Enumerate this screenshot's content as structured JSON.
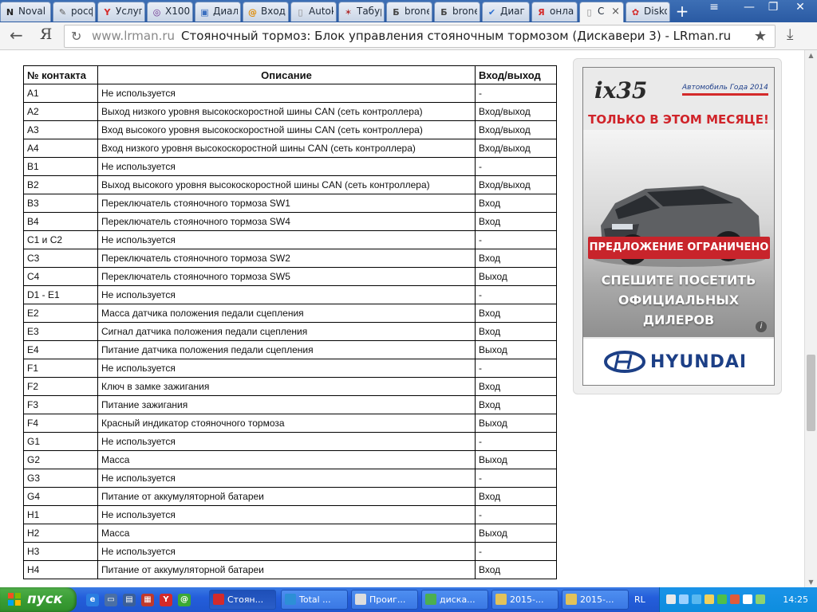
{
  "browser": {
    "tabs": [
      {
        "label": "Noval",
        "icon": "novalis-icon",
        "fav": "N",
        "fav_color": "#222222"
      },
      {
        "label": "росф",
        "icon": "feather-icon",
        "fav": "✎",
        "fav_color": "#555555"
      },
      {
        "label": "Услуг",
        "icon": "yandex-icon",
        "fav": "Y",
        "fav_color": "#d42a2a"
      },
      {
        "label": "X100",
        "icon": "x100-icon",
        "fav": "◎",
        "fav_color": "#6a2c8c"
      },
      {
        "label": "Диал",
        "icon": "dialog-icon",
        "fav": "▣",
        "fav_color": "#3a6fc0"
      },
      {
        "label": "Вход",
        "icon": "login-icon",
        "fav": "@",
        "fav_color": "#e08a00"
      },
      {
        "label": "Autok",
        "icon": "page-icon",
        "fav": "▯",
        "fav_color": "#888888"
      },
      {
        "label": "Табур",
        "icon": "star-badge-icon",
        "fav": "✶",
        "fav_color": "#b03030"
      },
      {
        "label": "brone",
        "icon": "b-icon",
        "fav": "Б",
        "fav_color": "#444444"
      },
      {
        "label": "brone",
        "icon": "b-icon",
        "fav": "Б",
        "fav_color": "#444444"
      },
      {
        "label": "Диаг",
        "icon": "check-icon",
        "fav": "✔",
        "fav_color": "#2d6fd0"
      },
      {
        "label": "онлаі",
        "icon": "yandex-ya-icon",
        "fav": "Я",
        "fav_color": "#d42a2a"
      },
      {
        "label": "С",
        "icon": "page-icon",
        "fav": "▯",
        "fav_color": "#888888",
        "active": true
      },
      {
        "label": "Disko",
        "icon": "disko-icon",
        "fav": "✿",
        "fav_color": "#d42a2a"
      }
    ],
    "new_tab": "+",
    "close_tab": "×",
    "window_buttons": {
      "menu": "≡",
      "minimize": "—",
      "maximize": "❐",
      "close": "✕"
    },
    "address": {
      "domain": "www.lrman.ru",
      "title": "Стояночный тормоз: Блок управления стояночным тормозом (Дискавери 3) - LRman.ru"
    },
    "nav": {
      "back": "←",
      "yandex": "Я",
      "reload": "↻",
      "star": "★",
      "download": "⤓"
    }
  },
  "table": {
    "headers": [
      "№ контакта",
      "Описание",
      "Вход/выход"
    ],
    "rows": [
      [
        "A1",
        "Не используется",
        "-"
      ],
      [
        "A2",
        "Выход низкого уровня высокоскоростной шины CAN (сеть контроллера)",
        "Вход/выход"
      ],
      [
        "A3",
        "Вход высокого уровня высокоскоростной шины CAN (сеть контроллера)",
        "Вход/выход"
      ],
      [
        "A4",
        "Вход низкого уровня высокоскоростной шины CAN (сеть контроллера)",
        "Вход/выход"
      ],
      [
        "B1",
        "Не используется",
        "-"
      ],
      [
        "B2",
        "Выход высокого уровня высокоскоростной шины CAN (сеть контроллера)",
        "Вход/выход"
      ],
      [
        "B3",
        "Переключатель стояночного тормоза SW1",
        "Вход"
      ],
      [
        "B4",
        "Переключатель стояночного тормоза SW4",
        "Вход"
      ],
      [
        "C1 и C2",
        "Не используется",
        "-"
      ],
      [
        "C3",
        "Переключатель стояночного тормоза SW2",
        "Вход"
      ],
      [
        "C4",
        "Переключатель стояночного тормоза SW5",
        "Выход"
      ],
      [
        "D1 - E1",
        "Не используется",
        "-"
      ],
      [
        "E2",
        "Масса датчика положения педали сцепления",
        "Вход"
      ],
      [
        "E3",
        "Сигнал датчика положения педали сцепления",
        "Вход"
      ],
      [
        "E4",
        "Питание датчика положения педали сцепления",
        "Выход"
      ],
      [
        "F1",
        "Не используется",
        "-"
      ],
      [
        "F2",
        "Ключ в замке зажигания",
        "Вход"
      ],
      [
        "F3",
        "Питание зажигания",
        "Вход"
      ],
      [
        "F4",
        "Красный индикатор стояночного тормоза",
        "Выход"
      ],
      [
        "G1",
        "Не используется",
        "-"
      ],
      [
        "G2",
        "Масса",
        "Выход"
      ],
      [
        "G3",
        "Не используется",
        "-"
      ],
      [
        "G4",
        "Питание от аккумуляторной батареи",
        "Вход"
      ],
      [
        "H1",
        "Не используется",
        "-"
      ],
      [
        "H2",
        "Масса",
        "Выход"
      ],
      [
        "H3",
        "Не используется",
        "-"
      ],
      [
        "H4",
        "Питание от аккумуляторной батареи",
        "Вход"
      ]
    ]
  },
  "ad": {
    "model": "ix35",
    "award": "Автомобиль Года 2014",
    "headline": "ТОЛЬКО В ЭТОМ МЕСЯЦЕ!",
    "banner": "ПРЕДЛОЖЕНИЕ ОГРАНИЧЕНО",
    "cta_lines": [
      "СПЕШИТЕ ПОСЕТИТЬ",
      "ОФИЦИАЛЬНЫХ",
      "ДИЛЕРОВ"
    ],
    "info": "i",
    "plate": "ix35",
    "brand": "HYUNDAI",
    "colors": {
      "headline": "#d0242a",
      "banner": "#c8242b",
      "brand": "#1c3f86"
    }
  },
  "taskbar": {
    "start_label": "пуск",
    "quick_launch": [
      {
        "icon": "ie-icon",
        "color": "#2a7de1",
        "glyph": "e"
      },
      {
        "icon": "desktop-icon",
        "color": "#4a6fa5",
        "glyph": "▭"
      },
      {
        "icon": "media-icon",
        "color": "#3a5f99",
        "glyph": "▤"
      },
      {
        "icon": "pdf-icon",
        "color": "#c0392b",
        "glyph": "▦"
      },
      {
        "icon": "yandex-browser-icon",
        "color": "#d42a2a",
        "glyph": "Y"
      },
      {
        "icon": "icq-icon",
        "color": "#3ba935",
        "glyph": "@"
      }
    ],
    "tasks": [
      {
        "label": "Стоян...",
        "icon": "yandex-browser-icon",
        "color": "#d42a2a",
        "active": true
      },
      {
        "label": "Total ...",
        "icon": "total-commander-icon",
        "color": "#2d8fd6"
      },
      {
        "label": "Проиг...",
        "icon": "player-icon",
        "color": "#dddddd"
      },
      {
        "label": "диска...",
        "icon": "image-icon",
        "color": "#4caf50"
      },
      {
        "label": "2015-...",
        "icon": "folder-icon",
        "color": "#e2c25a"
      },
      {
        "label": "2015-...",
        "icon": "folder-icon",
        "color": "#e2c25a"
      }
    ],
    "language": "RL",
    "clock": "14:25",
    "tray_icons": [
      "network-icon",
      "volume-icon",
      "skype-icon",
      "antivirus-icon",
      "icq-tray-icon",
      "java-icon",
      "speaker-icon",
      "safe-remove-icon"
    ]
  }
}
